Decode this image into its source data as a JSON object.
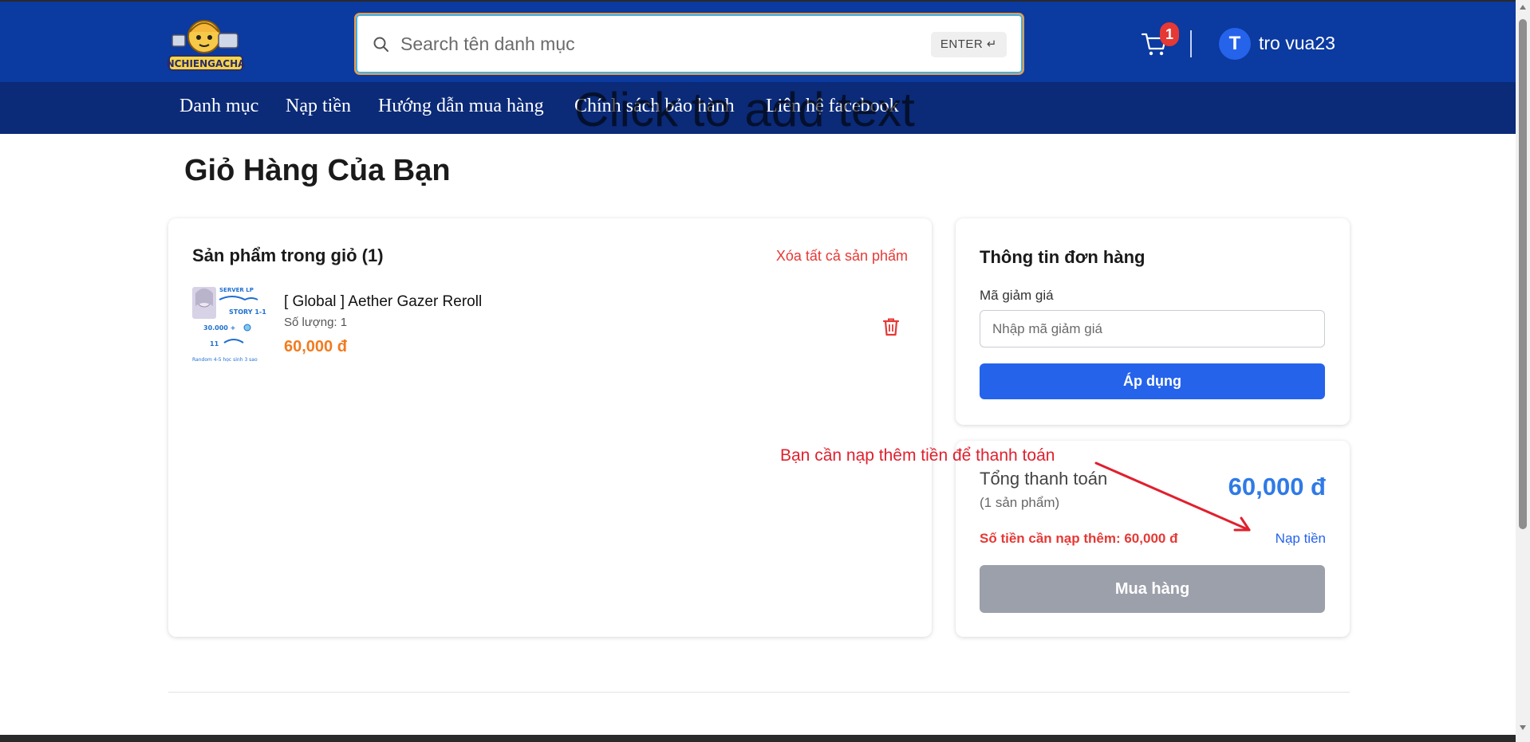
{
  "header": {
    "logo_alt": "NCHIENGACHA",
    "search_placeholder": "Search tên danh mục",
    "enter_hint": "ENTER ↵",
    "cart_count": "1",
    "user_initial": "T",
    "username": "tro vua23"
  },
  "nav": {
    "items": [
      "Danh mục",
      "Nạp tiền",
      "Hướng dẫn mua hàng",
      "Chính sách bảo hành",
      "Liên hệ facebook"
    ],
    "overlay_text": "Click to add text"
  },
  "page_title": "Giỏ Hàng Của Bạn",
  "cart": {
    "heading": "Sản phẩm trong giỏ (1)",
    "clear_all": "Xóa tất cả sản phẩm",
    "product": {
      "name": "[ Global ] Aether Gazer Reroll",
      "qty_label": "Số lượng: 1",
      "price": "60,000 đ",
      "thumb_lines": [
        "SERVER LP",
        "STORY 1-1",
        "30.000 +",
        "11",
        "Random 4-5 học sinh 3 sao"
      ]
    }
  },
  "order": {
    "heading": "Thông tin đơn hàng",
    "coupon_label": "Mã giảm giá",
    "coupon_placeholder": "Nhập mã giảm giá",
    "apply_label": "Áp dụng"
  },
  "total": {
    "label": "Tổng thanh toán",
    "count": "(1 sản phẩm)",
    "amount": "60,000 đ",
    "need_label": "Số tiền cần nạp thêm: 60,000 đ",
    "topup_label": "Nạp tiền",
    "buy_label": "Mua hàng"
  },
  "annotation": {
    "text": "Bạn cần nạp thêm tiền để thanh toán",
    "color": "#e0202e"
  },
  "colors": {
    "header_bg": "#0b3aa0",
    "nav_bg": "#0b2a78",
    "primary": "#2563eb",
    "danger": "#e53935",
    "price_orange": "#f27b1f",
    "disabled": "#9ca0aa"
  }
}
